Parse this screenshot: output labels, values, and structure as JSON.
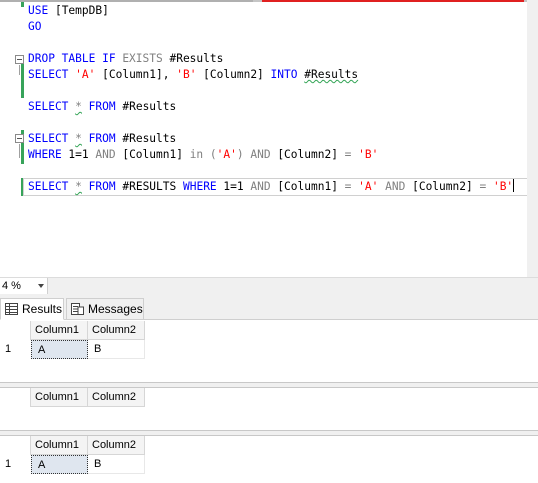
{
  "editor": {
    "line1": {
      "kw": "USE",
      "rest": " [TempDB]"
    },
    "line2": {
      "kw": "GO"
    },
    "line3": {
      "kw1": "DROP TABLE IF",
      "gr": "EXISTS",
      "rest": " #Results"
    },
    "line4": {
      "kw": "SELECT",
      "s1": "'A'",
      "c1": " [Column1], ",
      "s2": "'B'",
      "c2": " [Column2] ",
      "kw2": "INTO",
      "tbl": "#Results"
    },
    "line5": {
      "kw": "SELECT",
      "star": "*",
      "kw2": "FROM",
      "rest": " #Results"
    },
    "line6": {
      "kw": "SELECT",
      "star": "*",
      "kw2": "FROM",
      "rest": " #Results"
    },
    "line7": {
      "kw": "WHERE",
      "a": " 1=1 ",
      "and1": "AND",
      "b": " [Column1] ",
      "in": "in",
      "p1": " (",
      "s": "'A'",
      "p2": ") ",
      "and2": "AND",
      "c": " [Column2] ",
      "eq": "=",
      "s2": "'B'"
    },
    "line8": {
      "kw": "SELECT",
      "star": "*",
      "kw2": "FROM",
      "t": " #RESULTS ",
      "kw3": "WHERE",
      "a": " 1=1 ",
      "and1": "AND",
      "b": " [Column1] ",
      "eq1": "=",
      "s1": "'A'",
      "and2": "AND",
      "c": " [Column2] ",
      "eq2": "=",
      "s2": "'B'"
    }
  },
  "zoom": {
    "value": "4 %"
  },
  "tabs": {
    "results": "Results",
    "messages": "Messages"
  },
  "grids": [
    {
      "columns": [
        "Column1",
        "Column2"
      ],
      "rows": [
        {
          "num": "1",
          "c1": "A",
          "c2": "B"
        }
      ]
    },
    {
      "columns": [
        "Column1",
        "Column2"
      ],
      "rows": []
    },
    {
      "columns": [
        "Column1",
        "Column2"
      ],
      "rows": [
        {
          "num": "1",
          "c1": "A",
          "c2": "B"
        }
      ]
    }
  ],
  "colors": {
    "keyword": "#0000ff",
    "string": "#ff0000",
    "gray": "#808080",
    "gutter_green": "#37a35a"
  }
}
